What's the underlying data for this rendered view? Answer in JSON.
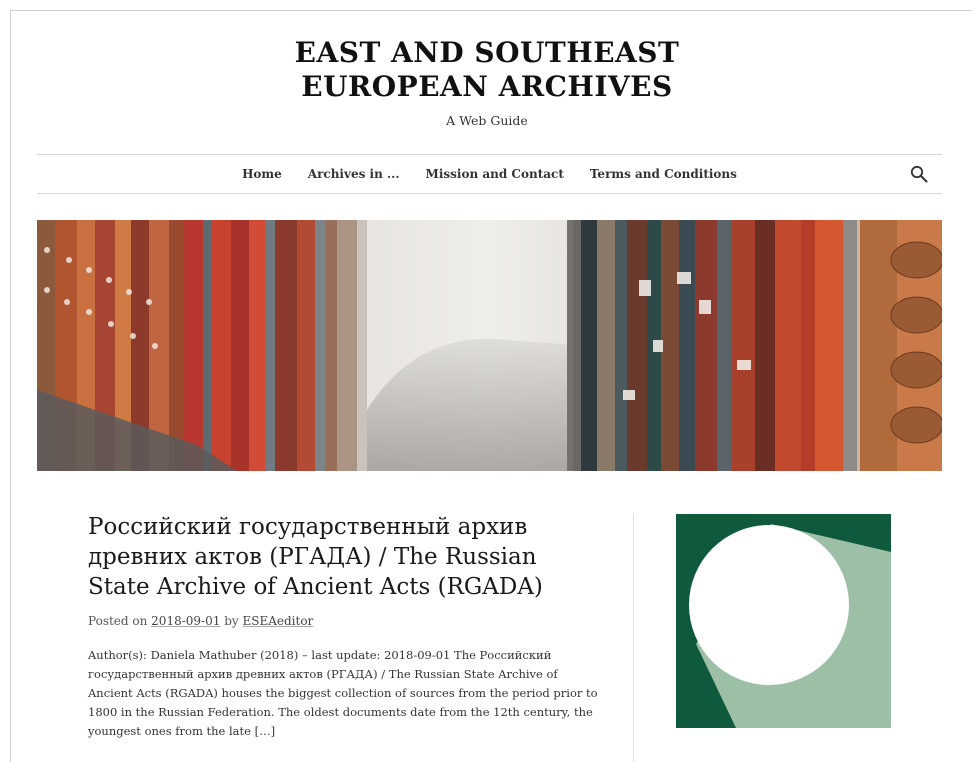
{
  "header": {
    "title_line1": "EAST AND SOUTHEAST",
    "title_line2": "EUROPEAN ARCHIVES",
    "tagline": "A Web Guide"
  },
  "nav": {
    "items": [
      {
        "label": "Home"
      },
      {
        "label": "Archives in ..."
      },
      {
        "label": "Mission and Contact"
      },
      {
        "label": "Terms and Conditions"
      }
    ],
    "search_icon": "search-icon"
  },
  "post": {
    "title": "Российский государственный архив древних актов (РГАДА) / The Russian State Archive of Ancient Acts (RGADA)",
    "meta_prefix": "Posted on",
    "date": "2018-09-01",
    "meta_by": "by",
    "author": "ESEAeditor",
    "excerpt": "Author(s): Daniela Mathuber (2018) – last update: 2018-09-01   The Российский государственный архив древних актов (РГАДА) / The Russian State Archive of Ancient Acts (RGADA) houses the biggest collection of sources from the period prior to 1800 in the Russian Federation. The oldest documents date from the 12th century, the youngest ones from the late […]"
  },
  "colors": {
    "logo_dark_green": "#0f5a3c",
    "logo_light_green": "#9dbfa6"
  }
}
